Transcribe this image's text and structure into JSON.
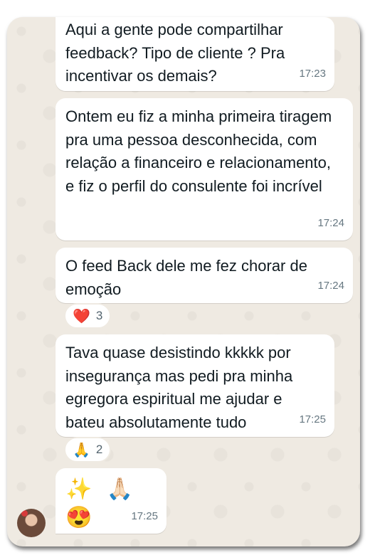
{
  "messages": [
    {
      "text": "Aqui a gente pode compartilhar feedback? Tipo de cliente ? Pra incentivar os demais?",
      "time": "17:23"
    },
    {
      "text": "Ontem eu fiz a minha primeira tiragem pra uma pessoa desconhecida, com relação a financeiro e relacionamento, e fiz o perfil do consulente foi incrível",
      "time": "17:24"
    },
    {
      "text": "O feed Back dele me fez chorar de emoção",
      "time": "17:24",
      "reaction": {
        "emoji": "❤️",
        "count": "3"
      }
    },
    {
      "text": "Tava quase desistindo kkkkk por insegurança mas pedi pra minha egregora espiritual me ajudar e bateu absolutamente tudo",
      "time": "17:25",
      "reaction": {
        "emoji": "🙏",
        "count": "2"
      }
    },
    {
      "text": "✨ 🙏🏻 😍",
      "time": "17:25"
    }
  ],
  "colors": {
    "chat_background": "#efeae2",
    "bubble": "#ffffff",
    "timestamp": "#667781"
  },
  "icons": {
    "avatar": "sender-avatar"
  }
}
